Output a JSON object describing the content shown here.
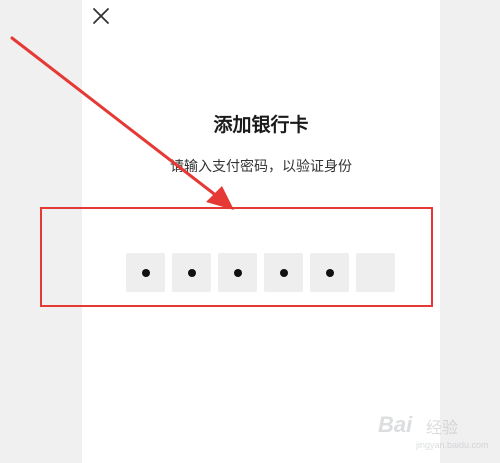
{
  "header": {
    "close_icon": "close-icon"
  },
  "dialog": {
    "title": "添加银行卡",
    "subtitle": "请输入支付密码，以验证身份"
  },
  "pin": {
    "length": 6,
    "filled": 5
  },
  "annotation": {
    "color": "#e53935"
  },
  "watermark": {
    "logo": "Bai",
    "sub": "经验",
    "url": "jingyan.baidu.com"
  }
}
